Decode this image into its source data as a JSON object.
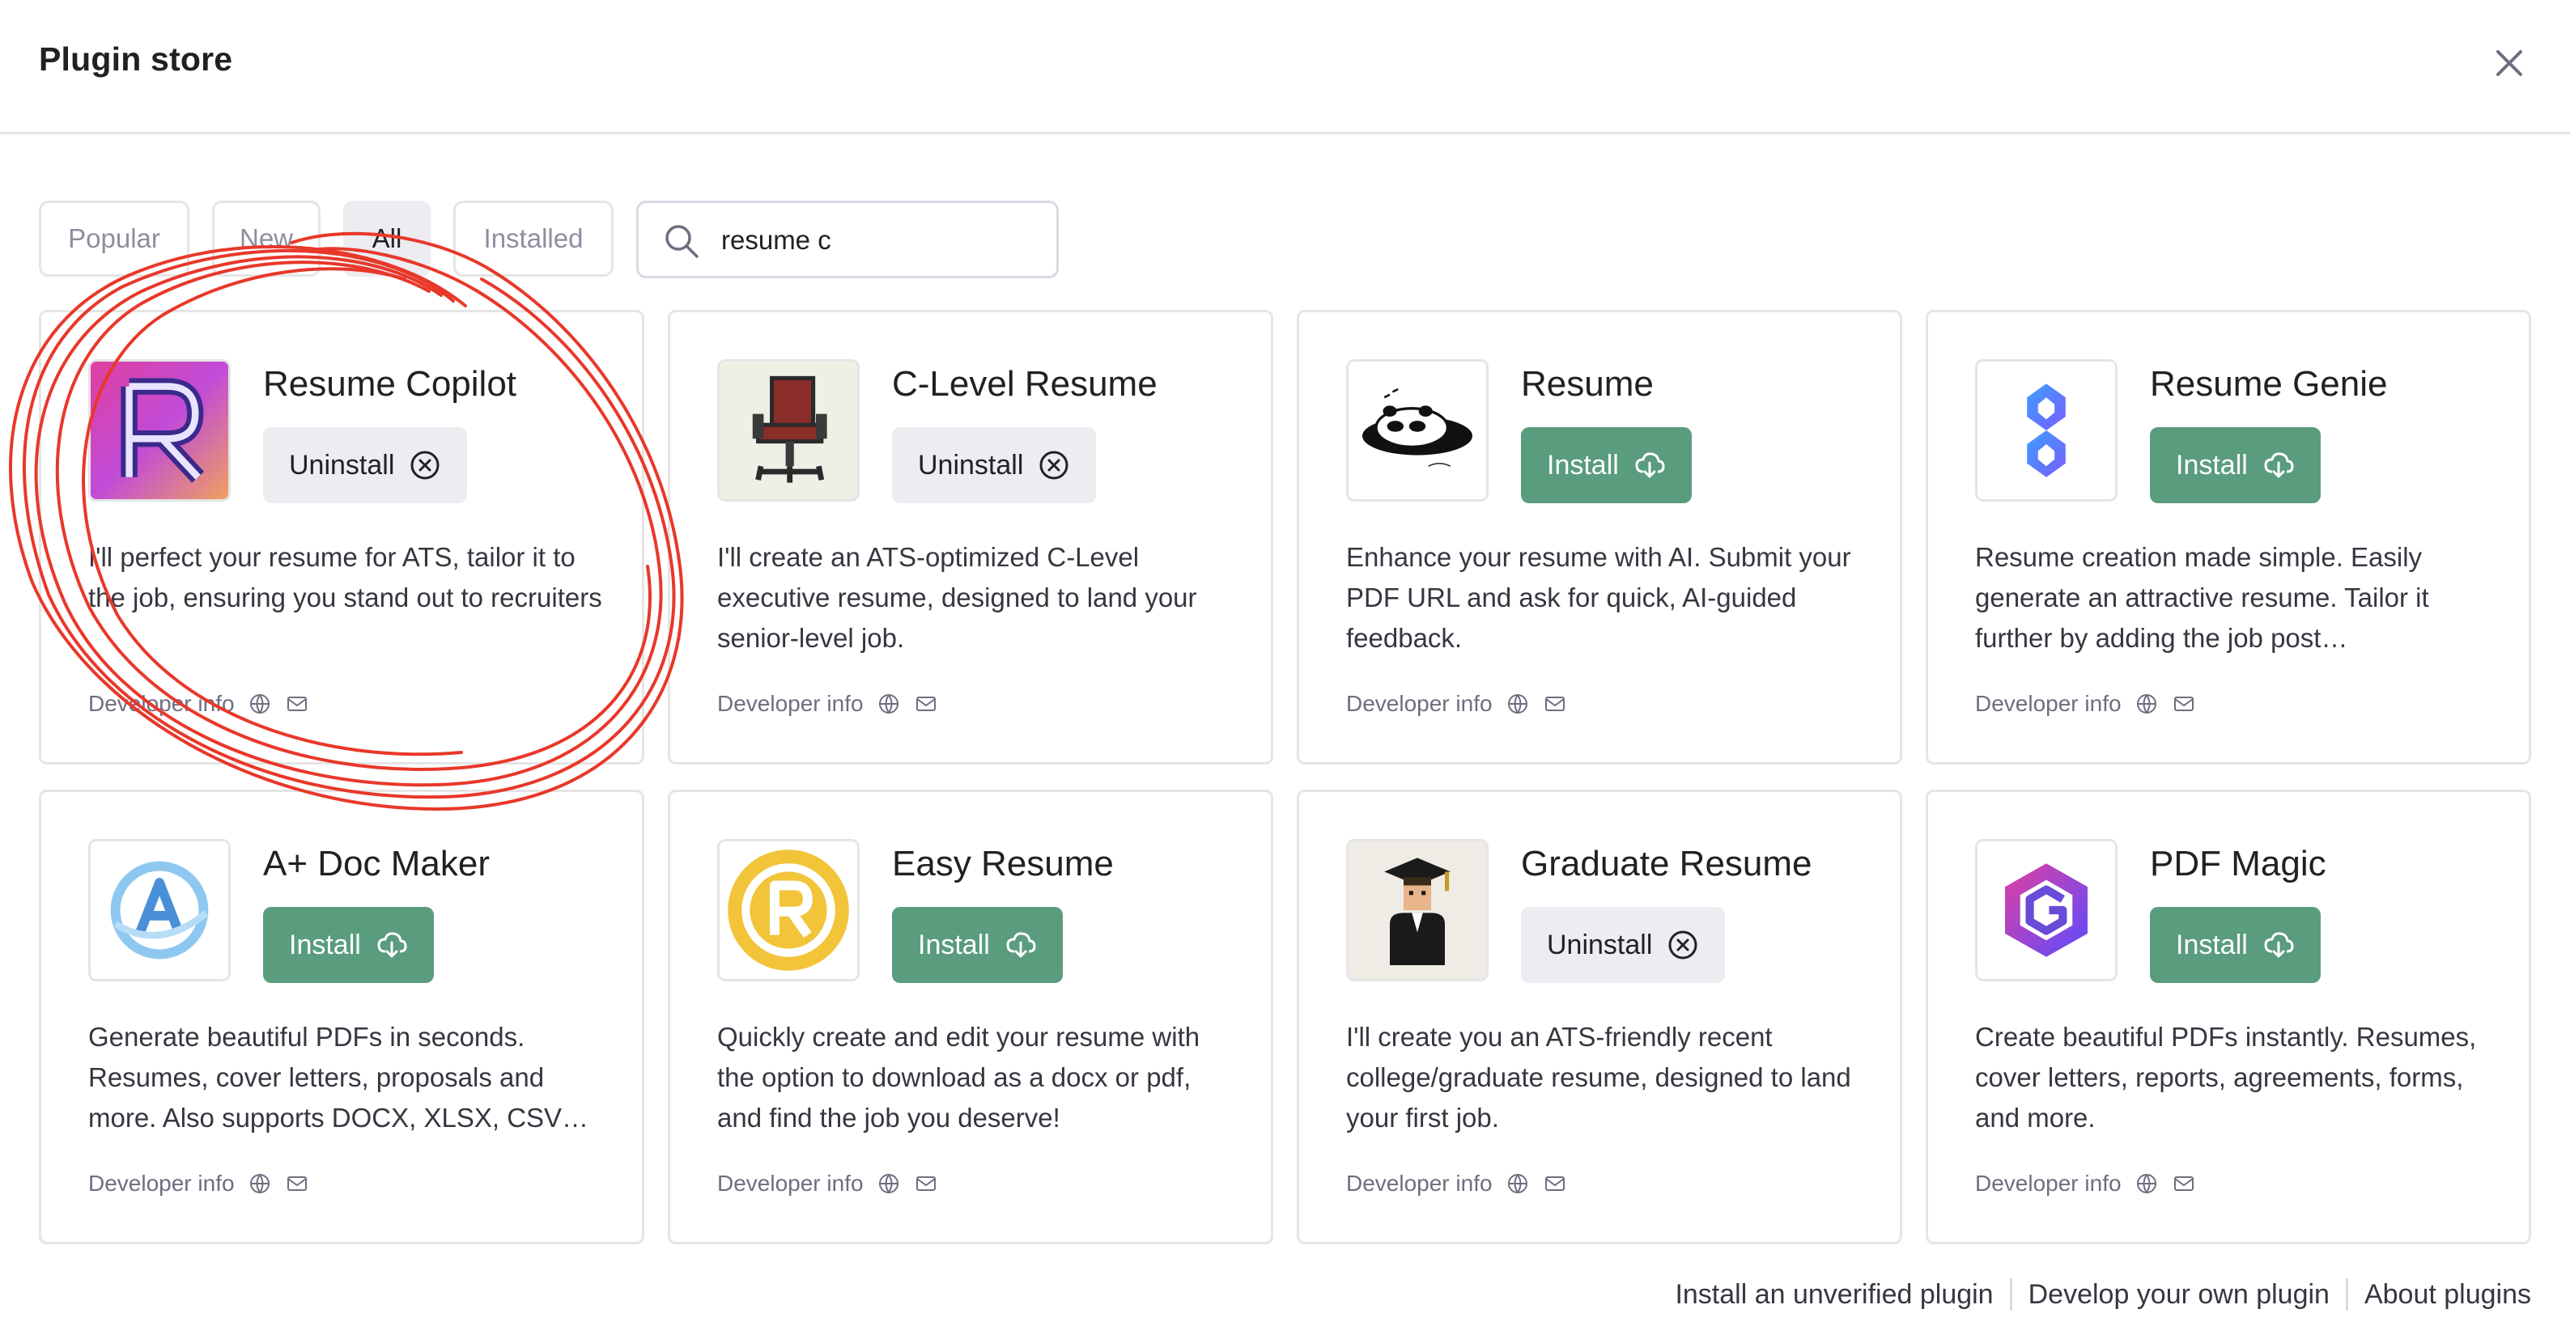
{
  "header": {
    "title": "Plugin store"
  },
  "tabs": [
    {
      "label": "Popular",
      "active": false
    },
    {
      "label": "New",
      "active": false
    },
    {
      "label": "All",
      "active": true
    },
    {
      "label": "Installed",
      "active": false
    }
  ],
  "search": {
    "value": "resume c"
  },
  "plugins": [
    {
      "name": "Resume Copilot",
      "button": "Uninstall",
      "state": "installed",
      "description": "I'll perfect your resume for ATS, tailor it to the job, ensuring you stand out to recruiters",
      "developer": "Developer info"
    },
    {
      "name": "C-Level Resume",
      "button": "Uninstall",
      "state": "installed",
      "description": "I'll create an ATS-optimized C-Level executive resume, designed to land your senior-level job.",
      "developer": "Developer info"
    },
    {
      "name": "Resume",
      "button": "Install",
      "state": "not-installed",
      "description": "Enhance your resume with AI. Submit your PDF URL and ask for quick, AI-guided feedback.",
      "developer": "Developer info"
    },
    {
      "name": "Resume Genie",
      "button": "Install",
      "state": "not-installed",
      "description": "Resume creation made simple. Easily generate an attractive resume. Tailor it further by adding the job post…",
      "developer": "Developer info"
    },
    {
      "name": "A+ Doc Maker",
      "button": "Install",
      "state": "not-installed",
      "description": "Generate beautiful PDFs in seconds. Resumes, cover letters, proposals and more. Also supports DOCX, XLSX, CSV…",
      "developer": "Developer info"
    },
    {
      "name": "Easy Resume",
      "button": "Install",
      "state": "not-installed",
      "description": "Quickly create and edit your resume with the option to download as a docx or pdf, and find the job you deserve!",
      "developer": "Developer info"
    },
    {
      "name": "Graduate Resume",
      "button": "Uninstall",
      "state": "installed",
      "description": "I'll create you an ATS-friendly recent college/graduate resume, designed to land your first job.",
      "developer": "Developer info"
    },
    {
      "name": "PDF Magic",
      "button": "Install",
      "state": "not-installed",
      "description": "Create beautiful PDFs instantly. Resumes, cover letters, reports, agreements, forms, and more.",
      "developer": "Developer info"
    }
  ],
  "footer": {
    "links": [
      "Install an unverified plugin",
      "Develop your own plugin",
      "About plugins"
    ]
  },
  "icons": {
    "close": "close-icon",
    "search": "search-icon",
    "uninstall": "circle-x-icon",
    "install": "cloud-download-icon",
    "website": "globe-icon",
    "email": "mail-icon"
  },
  "colors": {
    "install_button": "#5a9c7e",
    "uninstall_button": "#ececf1",
    "annotation": "#e8382a"
  }
}
